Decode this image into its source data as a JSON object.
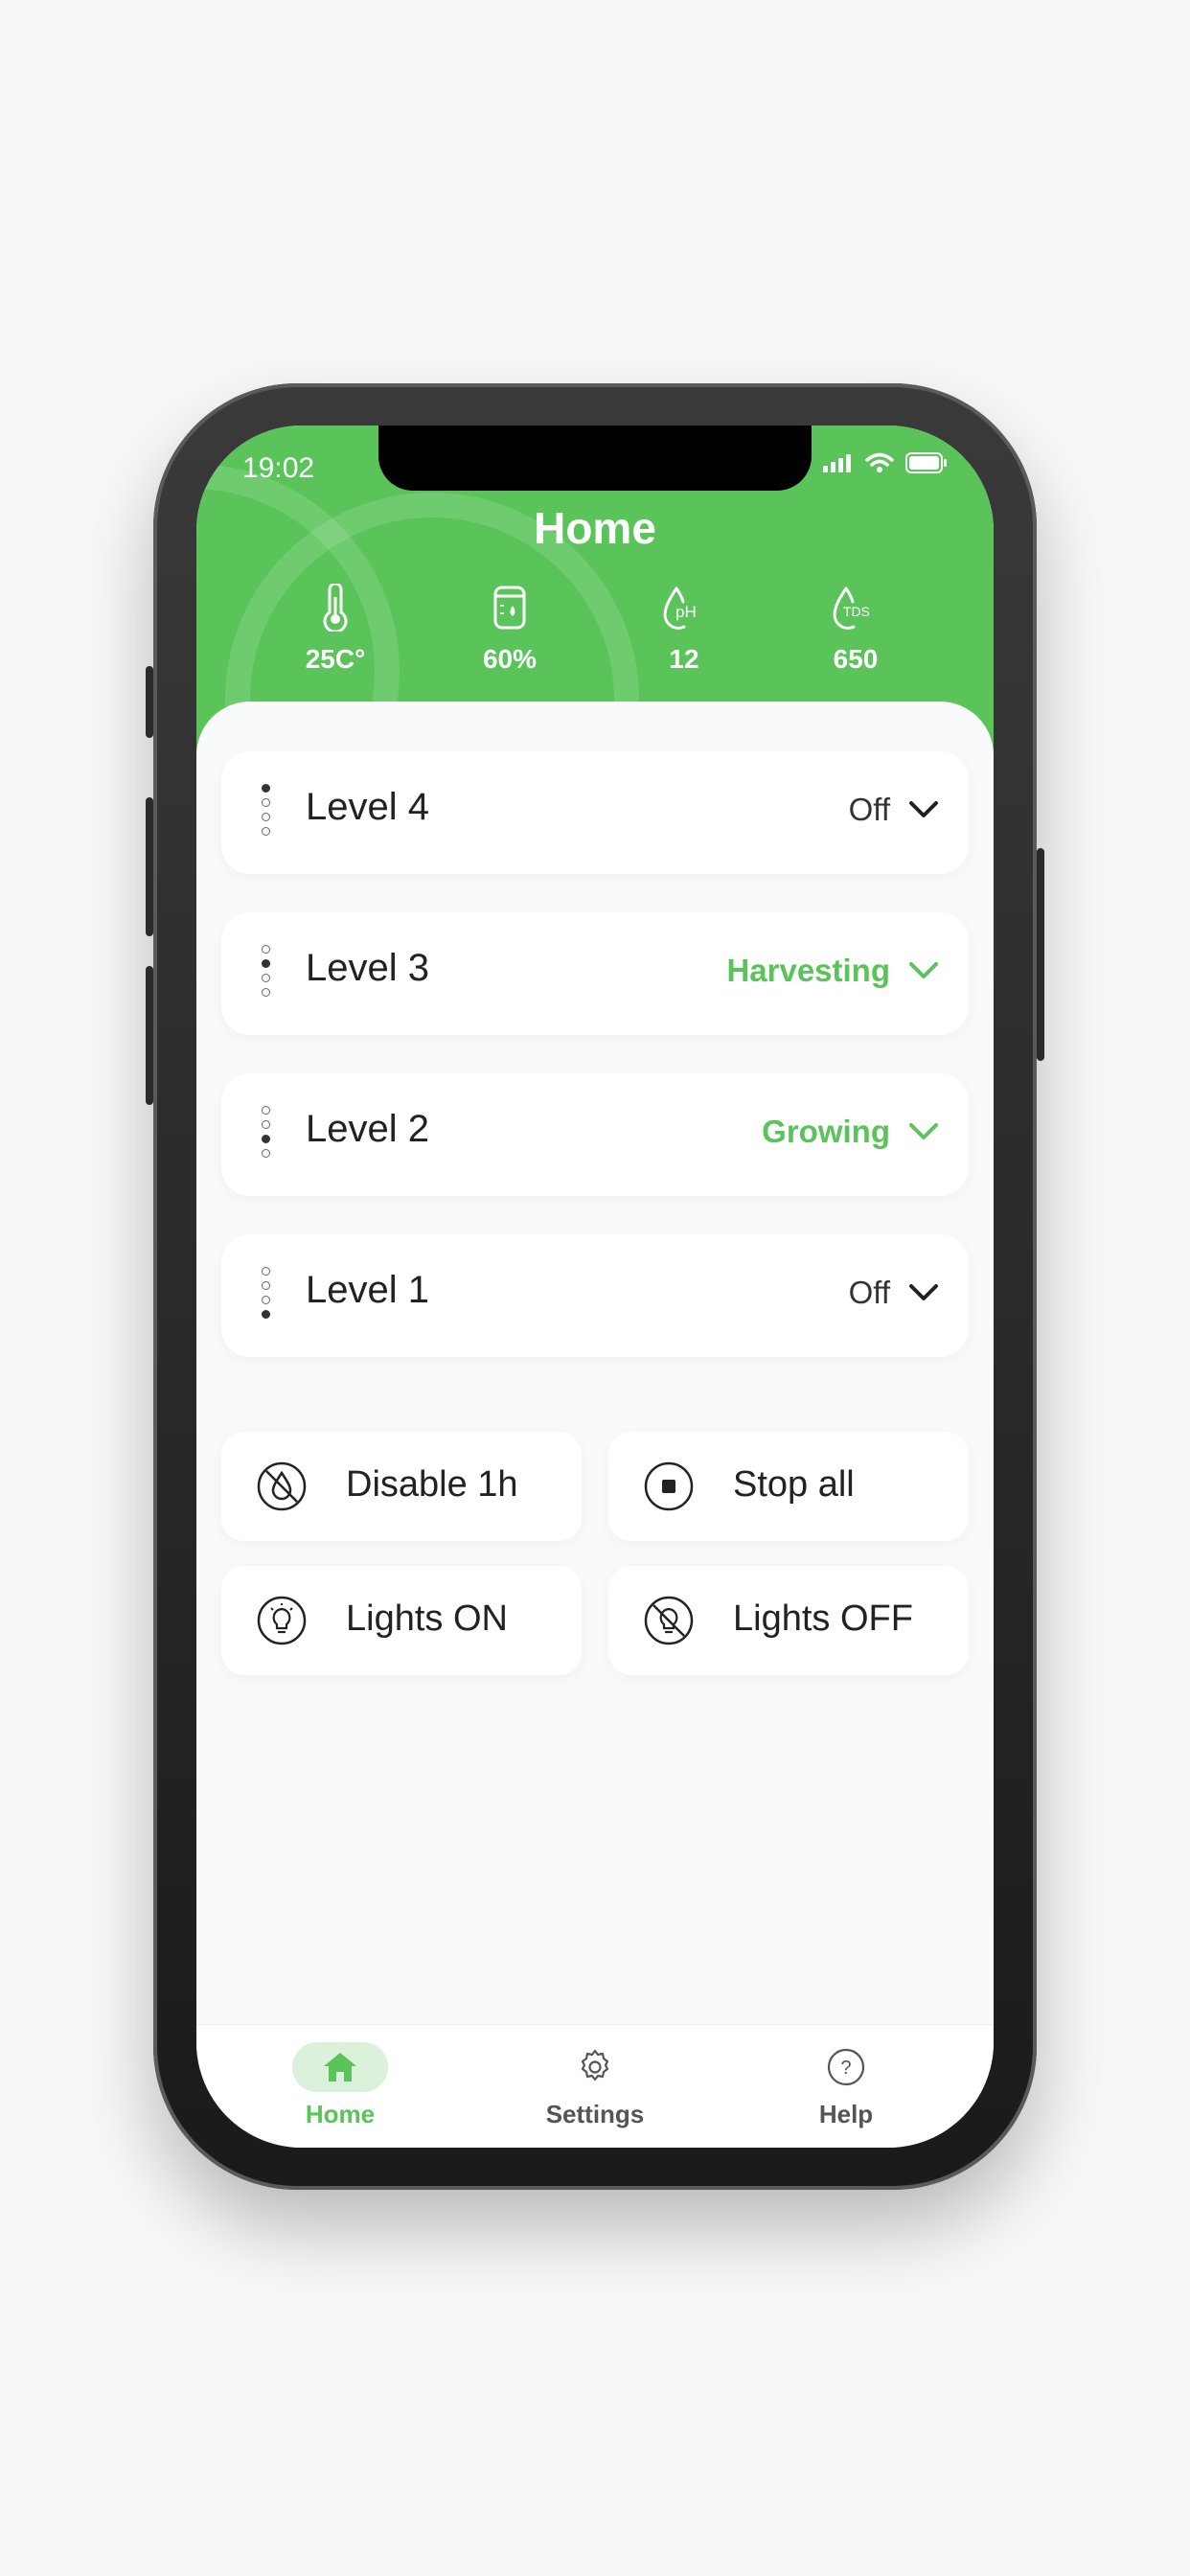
{
  "status_bar": {
    "time": "19:02"
  },
  "header": {
    "title": "Home"
  },
  "metrics": [
    {
      "icon": "thermometer-icon",
      "value": "25C°"
    },
    {
      "icon": "water-tank-icon",
      "value": "60%"
    },
    {
      "icon": "ph-drop-icon",
      "icon_text": "pH",
      "value": "12"
    },
    {
      "icon": "tds-drop-icon",
      "icon_text": "TDS",
      "value": "650"
    }
  ],
  "levels": [
    {
      "name": "Level 4",
      "status": "Off",
      "active_dot": 1
    },
    {
      "name": "Level 3",
      "status": "Harvesting",
      "active_dot": 2
    },
    {
      "name": "Level 2",
      "status": "Growing",
      "active_dot": 3
    },
    {
      "name": "Level 1",
      "status": "Off",
      "active_dot": 4
    }
  ],
  "actions": {
    "disable": "Disable 1h",
    "stop_all": "Stop all",
    "lights_on": "Lights ON",
    "lights_off": "Lights OFF"
  },
  "tabs": {
    "home": "Home",
    "settings": "Settings",
    "help": "Help"
  },
  "colors": {
    "accent": "#5ac45a",
    "background": "#f9fafc"
  }
}
